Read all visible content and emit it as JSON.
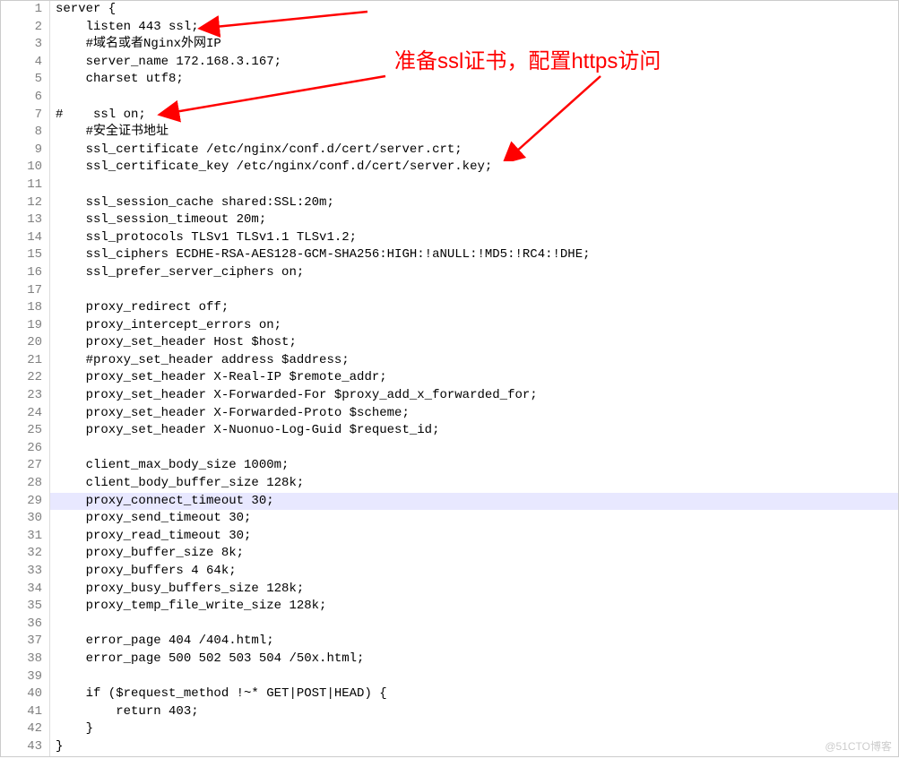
{
  "annotation": {
    "text": "准备ssl证书，配置https访问"
  },
  "watermark": "@51CTO博客",
  "highlight_line": 29,
  "code_lines": [
    "server {",
    "    listen 443 ssl;",
    "    #域名或者Nginx外网IP",
    "    server_name 172.168.3.167;",
    "    charset utf8;",
    "",
    "#    ssl on;",
    "    #安全证书地址",
    "    ssl_certificate /etc/nginx/conf.d/cert/server.crt;",
    "    ssl_certificate_key /etc/nginx/conf.d/cert/server.key;",
    "",
    "    ssl_session_cache shared:SSL:20m;",
    "    ssl_session_timeout 20m;",
    "    ssl_protocols TLSv1 TLSv1.1 TLSv1.2;",
    "    ssl_ciphers ECDHE-RSA-AES128-GCM-SHA256:HIGH:!aNULL:!MD5:!RC4:!DHE;",
    "    ssl_prefer_server_ciphers on;",
    "",
    "    proxy_redirect off;",
    "    proxy_intercept_errors on;",
    "    proxy_set_header Host $host;",
    "    #proxy_set_header address $address;",
    "    proxy_set_header X-Real-IP $remote_addr;",
    "    proxy_set_header X-Forwarded-For $proxy_add_x_forwarded_for;",
    "    proxy_set_header X-Forwarded-Proto $scheme;",
    "    proxy_set_header X-Nuonuo-Log-Guid $request_id;",
    "",
    "    client_max_body_size 1000m;",
    "    client_body_buffer_size 128k;",
    "    proxy_connect_timeout 30;",
    "    proxy_send_timeout 30;",
    "    proxy_read_timeout 30;",
    "    proxy_buffer_size 8k;",
    "    proxy_buffers 4 64k;",
    "    proxy_busy_buffers_size 128k;",
    "    proxy_temp_file_write_size 128k;",
    "",
    "    error_page 404 /404.html;",
    "    error_page 500 502 503 504 /50x.html;",
    "",
    "    if ($request_method !~* GET|POST|HEAD) {",
    "        return 403;",
    "    }",
    "}"
  ]
}
